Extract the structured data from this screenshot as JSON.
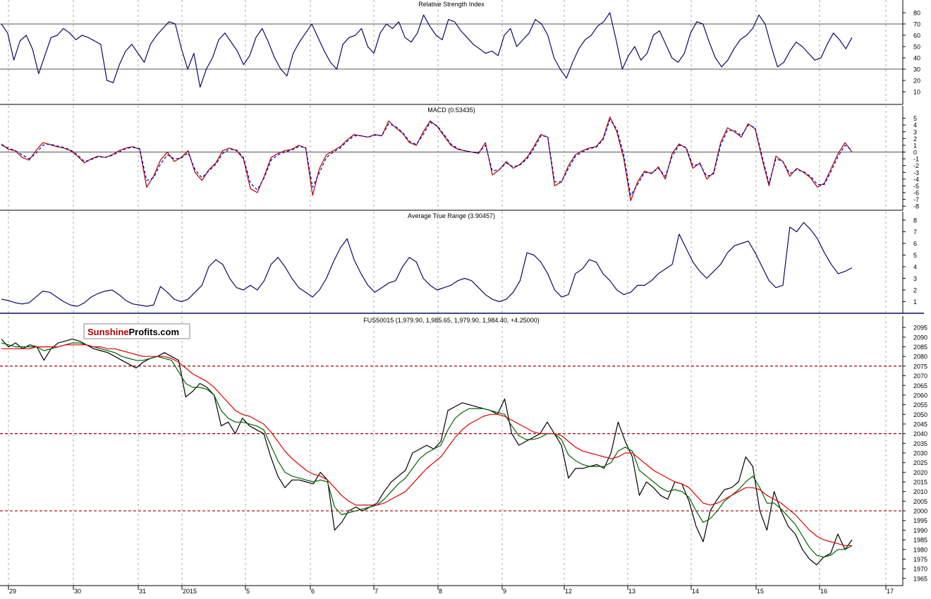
{
  "logo": {
    "part1": "Sunshine",
    "part2": "Profits",
    "part3": ".com"
  },
  "x_axis": {
    "labels": [
      "29",
      "30",
      "31",
      "2015",
      "5",
      "6",
      "7",
      "8",
      "9",
      "12",
      "13",
      "14",
      "15",
      "16",
      "17"
    ]
  },
  "colors": {
    "background": "#ffffff",
    "frame": "#000000",
    "grid": "#aaaaaa",
    "navy": "#0a0a64",
    "macd_line": "#b00000",
    "macd_signal": "#0000cc",
    "price": "#000000",
    "ma_fast": "#006400",
    "ma_slow": "#dd0000",
    "resistance": "#a00000",
    "logo_red": "#b00000"
  },
  "chart_data": [
    {
      "type": "line",
      "title": "Relative Strength Index",
      "ylim": [
        0,
        85
      ],
      "yticks": [
        10,
        20,
        30,
        40,
        50,
        60,
        70,
        80
      ],
      "reference_lines": [
        30,
        70
      ],
      "series": [
        {
          "values": [
            70,
            62,
            38,
            55,
            60,
            48,
            26,
            42,
            58,
            60,
            66,
            62,
            56,
            60,
            58,
            55,
            52,
            20,
            18,
            34,
            46,
            52,
            44,
            36,
            52,
            60,
            66,
            72,
            70,
            48,
            30,
            44,
            14,
            30,
            40,
            56,
            62,
            54,
            46,
            34,
            42,
            58,
            66,
            54,
            40,
            30,
            24,
            44,
            54,
            62,
            70,
            58,
            46,
            36,
            30,
            52,
            58,
            60,
            66,
            50,
            44,
            62,
            70,
            66,
            72,
            58,
            54,
            62,
            78,
            68,
            60,
            56,
            74,
            72,
            64,
            58,
            52,
            48,
            44,
            46,
            42,
            60,
            66,
            50,
            56,
            62,
            74,
            70,
            60,
            40,
            30,
            22,
            36,
            48,
            56,
            60,
            68,
            72,
            80,
            56,
            30,
            42,
            50,
            38,
            44,
            60,
            64,
            52,
            40,
            36,
            44,
            62,
            72,
            70,
            54,
            40,
            32,
            38,
            48,
            56,
            60,
            66,
            78,
            70,
            50,
            32,
            36,
            46,
            54,
            50,
            44,
            38,
            40,
            52,
            62,
            56,
            48,
            58
          ]
        }
      ]
    },
    {
      "type": "line",
      "title": "MACD (0.53435)",
      "ylim": [
        -8.5,
        6
      ],
      "yticks": [
        5,
        4,
        3,
        2,
        1,
        0,
        -1,
        -2,
        -3,
        -4,
        -5,
        -6,
        -7,
        -8
      ],
      "reference_lines": [
        0
      ],
      "series": [
        {
          "values": [
            1.2,
            0.4,
            0.2,
            -0.8,
            -1.2,
            0.2,
            1.4,
            1.1,
            0.8,
            0.6,
            0.2,
            -0.6,
            -1.6,
            -1.0,
            -0.6,
            -0.8,
            -0.4,
            0.2,
            0.6,
            0.8,
            0.4,
            -5.2,
            -3.6,
            -1.2,
            0.0,
            -1.4,
            -0.8,
            0.2,
            -3.0,
            -4.2,
            -2.6,
            -1.6,
            0.2,
            0.6,
            0.2,
            -1.0,
            -5.4,
            -6.0,
            -3.6,
            -0.8,
            -0.2,
            0.2,
            0.4,
            1.0,
            0.6,
            -6.4,
            -2.4,
            -0.4,
            0.2,
            0.8,
            1.8,
            2.6,
            2.4,
            2.2,
            2.6,
            2.4,
            4.6,
            3.6,
            2.8,
            1.4,
            1.0,
            3.0,
            4.6,
            3.8,
            2.4,
            1.0,
            0.4,
            0.2,
            0.0,
            -0.2,
            1.4,
            -3.4,
            -2.6,
            -1.4,
            -2.4,
            -1.8,
            -0.8,
            0.8,
            2.6,
            2.2,
            -5.0,
            -4.4,
            -2.0,
            -0.4,
            0.2,
            0.6,
            0.8,
            2.0,
            5.2,
            3.0,
            -1.0,
            -7.2,
            -4.4,
            -2.8,
            -3.2,
            -2.2,
            -4.0,
            -0.2,
            1.2,
            0.6,
            -2.4,
            -1.6,
            -4.0,
            -3.0,
            1.4,
            3.6,
            3.0,
            2.2,
            4.2,
            3.4,
            -1.0,
            -5.0,
            -0.6,
            -1.4,
            -3.6,
            -2.4,
            -3.0,
            -3.8,
            -5.2,
            -4.6,
            -2.4,
            -0.2,
            1.4,
            0.0
          ]
        },
        {
          "values": [
            1.0,
            0.6,
            0.2,
            -0.4,
            -1.0,
            -0.2,
            1.0,
            1.2,
            0.9,
            0.7,
            0.3,
            -0.4,
            -1.4,
            -1.1,
            -0.7,
            -0.8,
            -0.5,
            0.0,
            0.5,
            0.7,
            0.5,
            -4.2,
            -3.8,
            -1.8,
            -0.4,
            -1.0,
            -0.9,
            -0.1,
            -2.6,
            -3.8,
            -2.8,
            -1.8,
            -0.2,
            0.4,
            0.3,
            -0.8,
            -4.6,
            -5.6,
            -3.8,
            -1.2,
            -0.4,
            0.0,
            0.3,
            0.8,
            0.7,
            -5.2,
            -3.0,
            -0.8,
            0.0,
            0.6,
            1.6,
            2.4,
            2.4,
            2.2,
            2.5,
            2.4,
            4.2,
            3.8,
            2.9,
            1.6,
            1.1,
            2.6,
            4.4,
            3.9,
            2.6,
            1.2,
            0.5,
            0.2,
            0.0,
            -0.1,
            1.0,
            -2.8,
            -2.6,
            -1.6,
            -2.2,
            -1.9,
            -1.0,
            0.5,
            2.4,
            2.3,
            -4.4,
            -4.4,
            -2.4,
            -0.6,
            0.0,
            0.5,
            0.7,
            1.8,
            4.8,
            3.4,
            -0.4,
            -6.4,
            -4.8,
            -3.0,
            -3.1,
            -2.4,
            -3.6,
            -0.6,
            1.0,
            0.7,
            -2.0,
            -1.8,
            -3.6,
            -3.2,
            1.0,
            3.2,
            3.2,
            2.4,
            4.0,
            3.6,
            -0.6,
            -4.6,
            -1.0,
            -1.4,
            -3.2,
            -2.6,
            -2.9,
            -3.6,
            -4.8,
            -4.8,
            -2.8,
            -0.6,
            1.0,
            0.3
          ]
        }
      ]
    },
    {
      "type": "line",
      "title": "Average True Range (3.90457)",
      "ylim": [
        0,
        8
      ],
      "yticks": [
        1,
        2,
        3,
        4,
        5,
        6,
        7,
        8
      ],
      "series": [
        {
          "values": [
            1.2,
            1.1,
            0.9,
            0.8,
            0.9,
            1.4,
            1.9,
            1.8,
            1.4,
            1.0,
            0.7,
            0.6,
            0.9,
            1.4,
            1.7,
            1.9,
            2.0,
            1.6,
            1.1,
            0.8,
            0.7,
            0.6,
            0.7,
            2.3,
            1.8,
            1.2,
            1.0,
            1.2,
            1.8,
            2.4,
            4.0,
            4.6,
            4.2,
            3.0,
            2.2,
            2.0,
            2.4,
            2.0,
            2.8,
            4.2,
            4.8,
            4.0,
            3.0,
            2.2,
            1.8,
            1.4,
            2.0,
            3.0,
            4.4,
            5.6,
            6.4,
            4.6,
            3.4,
            2.4,
            1.8,
            2.2,
            2.6,
            2.8,
            4.0,
            4.8,
            4.4,
            3.0,
            2.4,
            2.0,
            2.2,
            2.4,
            2.8,
            3.0,
            2.8,
            2.2,
            1.6,
            1.2,
            1.0,
            1.2,
            1.8,
            2.8,
            5.2,
            5.0,
            4.4,
            3.4,
            2.0,
            1.4,
            1.6,
            3.4,
            3.8,
            4.6,
            4.4,
            3.4,
            2.8,
            2.0,
            1.6,
            1.8,
            2.4,
            2.4,
            2.8,
            3.4,
            3.8,
            4.2,
            6.8,
            5.6,
            4.4,
            3.6,
            3.0,
            3.6,
            4.2,
            5.2,
            5.8,
            6.0,
            6.2,
            5.2,
            4.0,
            2.8,
            2.2,
            2.4,
            7.4,
            7.0,
            7.8,
            7.2,
            6.4,
            5.2,
            4.2,
            3.4,
            3.6,
            3.9
          ]
        }
      ]
    },
    {
      "type": "line",
      "title": "FUS50015 (1,979.90, 1,985.65, 1,979.90, 1,984.40, +4.25000)",
      "ylim": [
        1962,
        2098
      ],
      "yticks": [
        2095,
        2090,
        2085,
        2080,
        2075,
        2070,
        2065,
        2060,
        2055,
        2050,
        2045,
        2040,
        2035,
        2030,
        2025,
        2020,
        2015,
        2010,
        2005,
        2000,
        1995,
        1990,
        1985,
        1980,
        1975,
        1970,
        1965
      ],
      "reference_lines": [
        2075,
        2040,
        2000
      ],
      "series": [
        {
          "values": [
            2089,
            2085,
            2087,
            2084,
            2086,
            2085,
            2078,
            2084,
            2087,
            2088,
            2089,
            2088,
            2086,
            2084,
            2083,
            2082,
            2080,
            2078,
            2076,
            2074,
            2077,
            2079,
            2080,
            2082,
            2080,
            2078,
            2059,
            2062,
            2066,
            2064,
            2060,
            2044,
            2046,
            2040,
            2048,
            2044,
            2042,
            2040,
            2028,
            2018,
            2012,
            2016,
            2016,
            2015,
            2014,
            2020,
            2016,
            1990,
            1994,
            2000,
            2002,
            2000,
            2002,
            2004,
            2010,
            2015,
            2018,
            2021,
            2030,
            2032,
            2034,
            2032,
            2036,
            2052,
            2054,
            2056,
            2055,
            2054,
            2053,
            2052,
            2050,
            2058,
            2040,
            2034,
            2036,
            2038,
            2040,
            2046,
            2040,
            2034,
            2017,
            2022,
            2022,
            2023,
            2024,
            2022,
            2030,
            2046,
            2036,
            2028,
            2008,
            2015,
            2012,
            2008,
            2006,
            2015,
            2014,
            2005,
            1992,
            1984,
            2000,
            2006,
            2011,
            2012,
            2015,
            2028,
            2023,
            2000,
            1990,
            2010,
            2000,
            1992,
            1988,
            1980,
            1975,
            1972,
            1976,
            1978,
            1988,
            1980,
            1985
          ]
        },
        {
          "values": [
            2087,
            2086,
            2085,
            2085,
            2085,
            2085,
            2083,
            2084,
            2085,
            2086,
            2087,
            2087,
            2086,
            2085,
            2084,
            2083,
            2082,
            2080,
            2079,
            2078,
            2078,
            2079,
            2080,
            2079,
            2078,
            2072,
            2066,
            2064,
            2064,
            2063,
            2060,
            2052,
            2048,
            2046,
            2046,
            2045,
            2044,
            2042,
            2034,
            2026,
            2020,
            2018,
            2017,
            2016,
            2015,
            2016,
            2015,
            2002,
            1998,
            1999,
            2000,
            2001,
            2002,
            2003,
            2006,
            2010,
            2014,
            2017,
            2022,
            2027,
            2030,
            2032,
            2034,
            2042,
            2048,
            2051,
            2053,
            2053,
            2053,
            2052,
            2051,
            2050,
            2044,
            2039,
            2037,
            2037,
            2038,
            2040,
            2040,
            2037,
            2029,
            2026,
            2024,
            2023,
            2023,
            2023,
            2025,
            2031,
            2033,
            2031,
            2021,
            2018,
            2015,
            2012,
            2010,
            2011,
            2010,
            2007,
            2000,
            1994,
            1996,
            2000,
            2005,
            2008,
            2011,
            2015,
            2018,
            2012,
            2004,
            2004,
            2001,
            1997,
            1993,
            1987,
            1981,
            1977,
            1976,
            1977,
            1980,
            1980,
            1982
          ]
        },
        {
          "values": [
            2084,
            2084,
            2084,
            2084,
            2084,
            2085,
            2085,
            2085,
            2085,
            2086,
            2086,
            2086,
            2086,
            2085,
            2085,
            2084,
            2084,
            2083,
            2082,
            2081,
            2080,
            2080,
            2080,
            2080,
            2079,
            2077,
            2074,
            2071,
            2069,
            2067,
            2064,
            2060,
            2056,
            2052,
            2050,
            2049,
            2047,
            2045,
            2041,
            2036,
            2031,
            2027,
            2024,
            2021,
            2019,
            2018,
            2016,
            2012,
            2008,
            2005,
            2003,
            2003,
            2003,
            2003,
            2004,
            2006,
            2008,
            2010,
            2014,
            2018,
            2022,
            2025,
            2028,
            2033,
            2038,
            2042,
            2045,
            2047,
            2049,
            2050,
            2050,
            2049,
            2047,
            2045,
            2043,
            2041,
            2040,
            2040,
            2040,
            2039,
            2036,
            2033,
            2031,
            2030,
            2029,
            2028,
            2027,
            2028,
            2030,
            2030,
            2027,
            2024,
            2021,
            2019,
            2017,
            2015,
            2014,
            2012,
            2008,
            2004,
            2003,
            2004,
            2006,
            2008,
            2010,
            2012,
            2012,
            2011,
            2008,
            2006,
            2004,
            2001,
            1998,
            1994,
            1990,
            1987,
            1985,
            1984,
            1983,
            1982,
            1982
          ]
        }
      ]
    }
  ]
}
